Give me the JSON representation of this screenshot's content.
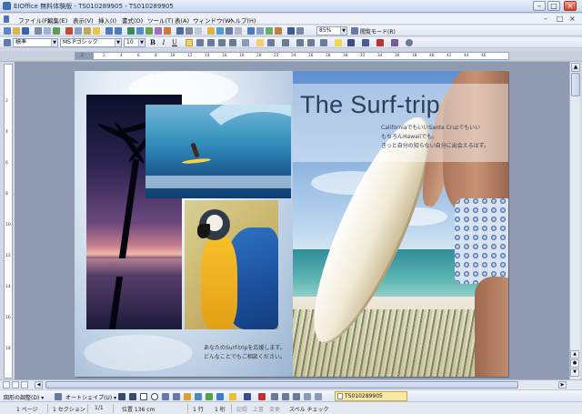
{
  "window": {
    "title": "EIOffice 無料体験版 - TS010289905 - TS010289905",
    "minimize": "–",
    "maximize": "□",
    "close": "×"
  },
  "menu": {
    "items": [
      "ファイル(F)",
      "編集(E)",
      "表示(V)",
      "挿入(I)",
      "書式(O)",
      "ツール(T)",
      "表(A)",
      "ウィンドウ(W)",
      "ヘルプ(H)"
    ],
    "doc_controls": [
      "–",
      "□",
      "×"
    ]
  },
  "toolbar_standard": {
    "zoom_value": "85%",
    "mode_label": "閲覧モード(R)"
  },
  "toolbar_format": {
    "style_value": "標準",
    "font_value": "MS Pゴシック",
    "size_value": "10",
    "bold": "B",
    "italic": "I",
    "underline": "U"
  },
  "rulers": {
    "corner": "L",
    "horizontal_ticks": [
      "2",
      "2",
      "4",
      "6",
      "8",
      "10",
      "12",
      "14",
      "16",
      "18",
      "20",
      "22",
      "24",
      "26",
      "28",
      "30",
      "32",
      "34",
      "36",
      "38",
      "40",
      "42",
      "44",
      "46"
    ],
    "vertical_ticks": [
      "2",
      "4",
      "6",
      "8",
      "10",
      "12",
      "14",
      "16",
      "18"
    ]
  },
  "document": {
    "title": "The Surf-trip",
    "lines": [
      "CaliforniaでもいいSanta Cruzでもいい",
      "もちろんHawaiiでも。",
      "きっと自分の知らない自分に出会えるはず。"
    ],
    "caption_left": [
      "あなたのSurf-tripを応援します。",
      "どんなことでもご相談ください。"
    ]
  },
  "drawbar": {
    "draw_menu": "図形の調整(D) ▾",
    "autoshape": "オートシェイプ(U) ▾",
    "task_tab": "TS010289905"
  },
  "status": {
    "page": "1 ページ",
    "section": "1 セクション",
    "page_count": "1/1",
    "position": "位置  136 cm",
    "line": "1 行",
    "column": "1 桁",
    "record": "記録",
    "overwrite": "上書",
    "change": "変更",
    "spell": "スペル チェック"
  },
  "icons": {
    "app": "eioffice-logo-icon",
    "accent_color": "#3a6db7"
  }
}
